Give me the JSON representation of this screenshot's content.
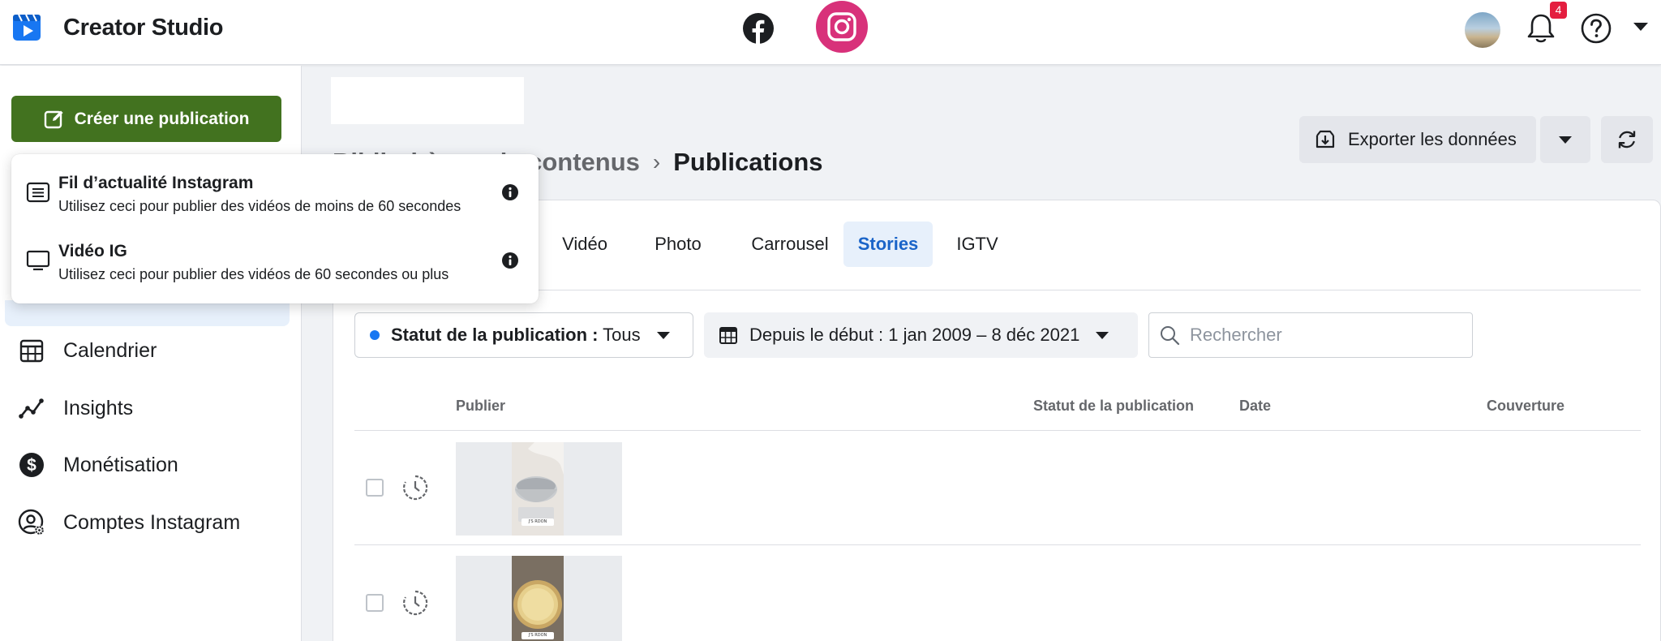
{
  "app": {
    "title": "Creator Studio"
  },
  "topbar": {
    "notification_count": "4",
    "platforms": [
      "facebook",
      "instagram"
    ],
    "active_platform": "instagram",
    "accent_instagram": "#d8317a"
  },
  "sidebar": {
    "create_label": "Créer une publication",
    "create_color": "#42721f",
    "items": [
      {
        "label": "Calendrier",
        "icon": "calendar-icon"
      },
      {
        "label": "Insights",
        "icon": "insights-icon"
      },
      {
        "label": "Monétisation",
        "icon": "dollar-icon"
      },
      {
        "label": "Comptes Instagram",
        "icon": "account-settings-icon"
      }
    ]
  },
  "dropdown": {
    "items": [
      {
        "title": "Fil d’actualité Instagram",
        "subtitle": "Utilisez ceci pour publier des vidéos de moins de 60 secondes",
        "icon": "feed-icon"
      },
      {
        "title": "Vidéo IG",
        "subtitle": "Utilisez ceci pour publier des vidéos de 60 secondes ou plus",
        "icon": "monitor-icon"
      }
    ]
  },
  "breadcrumb": {
    "parent": "Bibliothèque de contenus",
    "current": "Publications"
  },
  "toolbar": {
    "export_label": "Exporter les données"
  },
  "tabs": [
    {
      "label": "Vidéo",
      "active": false
    },
    {
      "label": "Photo",
      "active": false
    },
    {
      "label": "Carrousel",
      "active": false
    },
    {
      "label": "Stories",
      "active": true
    },
    {
      "label": "IGTV",
      "active": false
    }
  ],
  "filters": {
    "status_label": "Statut de la publication :",
    "status_value": "Tous",
    "date_label": "Depuis le début : 1 jan 2009 – 8 déc 2021",
    "search_placeholder": "Rechercher"
  },
  "table": {
    "headers": [
      "Publier",
      "Statut de la publication",
      "Date",
      "Couverture"
    ],
    "rows": [
      {
        "thumb_caption": "J'S RDON",
        "thumb_desc": "sieve-and-bowl"
      },
      {
        "thumb_caption": "J'S RDON",
        "thumb_desc": "tart-shell"
      }
    ]
  }
}
